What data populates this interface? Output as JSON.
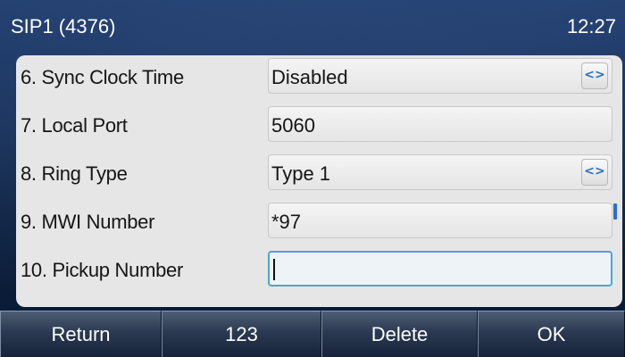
{
  "status_bar": {
    "account_title": "SIP1 (4376)",
    "time": "12:27"
  },
  "settings": {
    "rows": [
      {
        "label": "6. Sync Clock Time",
        "value": "Disabled",
        "control": "selector"
      },
      {
        "label": "7. Local Port",
        "value": "5060",
        "control": "text"
      },
      {
        "label": "8. Ring Type",
        "value": "Type 1",
        "control": "selector"
      },
      {
        "label": "9. MWI Number",
        "value": "*97",
        "control": "text"
      },
      {
        "label": "10. Pickup Number",
        "value": "",
        "control": "text",
        "focused": true
      }
    ],
    "selector_glyph": "<>"
  },
  "softkeys": {
    "return_label": "Return",
    "input_mode_label": "123",
    "delete_label": "Delete",
    "ok_label": "OK"
  },
  "colors": {
    "focus_border": "#4aa5d6",
    "selector_arrow": "#2a6fc0",
    "scroll_indicator": "#2d6bd0"
  }
}
